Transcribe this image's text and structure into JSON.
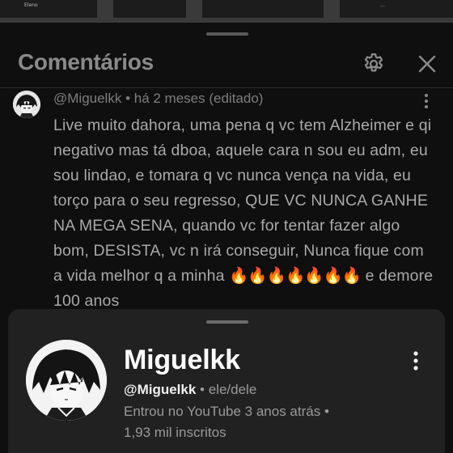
{
  "video_strip": {
    "left_label": "Eleno",
    "right_label": "...",
    "colors": {
      "background": "#3a3a3a"
    }
  },
  "comments_panel": {
    "title": "Comentários",
    "settings_icon": "gear-icon",
    "close_icon": "close-icon"
  },
  "comment": {
    "author": "@Miguelkk",
    "separator": " • ",
    "time": "há 2 meses (editado)",
    "text": "Live muito dahora, uma pena q vc tem Alzheimer e qi negativo mas tá dboa, aquele cara n sou eu adm, eu sou lindao, e tomara q vc nunca vença na vida, eu torço para o seu regresso, QUE VC NUNCA GANHE NA MEGA SENA, quando vc for tentar fazer algo bom, DESISTA, vc n irá conseguir, Nunca fique com a vida melhor q a minha",
    "fire_emojis": "🔥🔥🔥🔥🔥🔥🔥",
    "text_end": " e demore 100 anos",
    "more_icon": "more-vertical-icon"
  },
  "profile_card": {
    "name": "Miguelkk",
    "handle": "@Miguelkk",
    "pronouns": " • ele/dele",
    "joined": "Entrou no YouTube 3 anos atrás •",
    "subscribers": "1,93 mil inscritos",
    "more_icon": "more-vertical-icon",
    "colors": {
      "card_background": "#212121",
      "panel_background": "#0f0f0f"
    }
  }
}
